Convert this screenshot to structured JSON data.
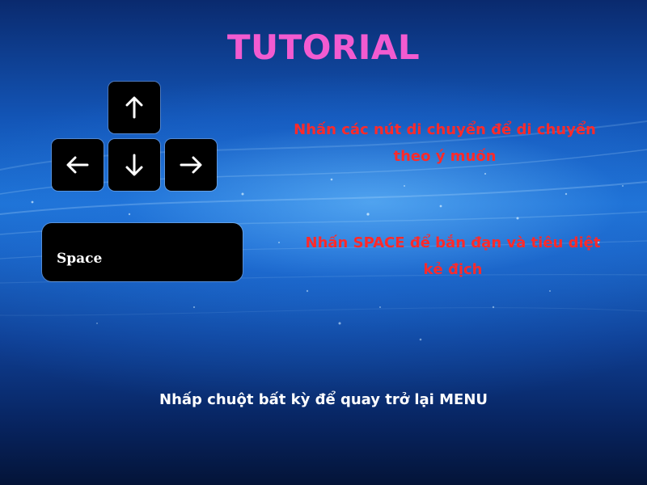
{
  "screen": {
    "title": "TUTORIAL",
    "title_color": "#f25bd0",
    "instruction_color": "#ff2a2a",
    "footer_color": "#ffffff"
  },
  "controls": {
    "arrow_keys": {
      "up": "arrow-up-icon",
      "left": "arrow-left-icon",
      "down": "arrow-down-icon",
      "right": "arrow-right-icon"
    },
    "space_key_label": "Space"
  },
  "instructions": {
    "move_line1": "Nhấn các nút di chuyển để di chuyển",
    "move_line2": "theo ý muốn",
    "shoot_line1": "Nhấn SPACE để bắn đạn và tiêu diệt",
    "shoot_line2": "kẻ địch"
  },
  "footer": {
    "return_hint": "Nhấp chuột bất kỳ để quay trở lại MENU"
  }
}
